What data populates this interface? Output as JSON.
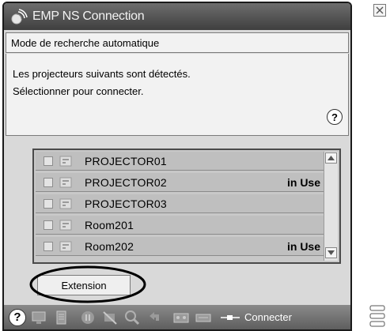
{
  "window": {
    "title": "EMP NS Connection"
  },
  "mode": {
    "label": "Mode de recherche automatique"
  },
  "info": {
    "line1": "Les projecteurs suivants sont détectés.",
    "line2": "Sélectionner pour connecter.",
    "help_glyph": "?"
  },
  "projectors": [
    {
      "name": "PROJECTOR01",
      "status": ""
    },
    {
      "name": "PROJECTOR02",
      "status": "in Use"
    },
    {
      "name": "PROJECTOR03",
      "status": ""
    },
    {
      "name": "Room201",
      "status": ""
    },
    {
      "name": "Room202",
      "status": "in Use"
    }
  ],
  "buttons": {
    "extension": "Extension",
    "connect": "Connecter"
  },
  "toolbar": {
    "help_glyph": "?"
  },
  "icons": {
    "app": "wifi-globe-icon",
    "close": "close-icon",
    "device": "projector-icon",
    "scroll_up": "scroll-up-arrow-icon",
    "scroll_down": "scroll-down-arrow-icon",
    "plug": "plug-icon",
    "handle": "grip-icon"
  },
  "colors": {
    "titlebar": "#4f4f4f",
    "panel": "#f2f2f2",
    "list_row": "#bfbfbf",
    "toolbar": "#6e6e6e"
  }
}
